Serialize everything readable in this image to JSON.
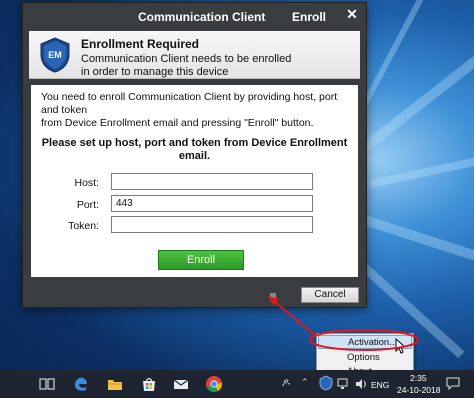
{
  "window": {
    "title": "Communication Client",
    "section": "Enroll",
    "close_glyph": "✕"
  },
  "header": {
    "title": "Enrollment Required",
    "description_line1": "Communication Client needs to be enrolled",
    "description_line2": "in order to manage this device",
    "logo_text": "EM"
  },
  "content": {
    "intro_line1": "You need to enroll Communication Client by providing host, port and token",
    "intro_line2": "from Device Enrollment email and pressing \"Enroll\" button.",
    "instruction_line1": "Please set up host, port and token from Device Enrollment",
    "instruction_line2": "email.",
    "fields": {
      "host": {
        "label": "Host:",
        "value": ""
      },
      "port": {
        "label": "Port:",
        "value": "443"
      },
      "token": {
        "label": "Token:",
        "value": ""
      }
    },
    "enroll_label": "Enroll"
  },
  "footer": {
    "cancel_label": "Cancel"
  },
  "context_menu": {
    "items": [
      "Activation...",
      "Options",
      "About"
    ],
    "highlighted": "Activation..."
  },
  "taskbar": {
    "time": "2:35",
    "date": "24-10-2018",
    "language": "ENG",
    "icons": [
      "task-view-icon",
      "edge-icon",
      "file-explorer-icon",
      "store-icon",
      "mail-icon",
      "chrome-icon"
    ]
  },
  "colors": {
    "dialog_bg": "#3a3d40",
    "enroll_green": "#3aaf34",
    "annotation_red": "#e3141b",
    "taskbar_bg": "#1e2530"
  }
}
